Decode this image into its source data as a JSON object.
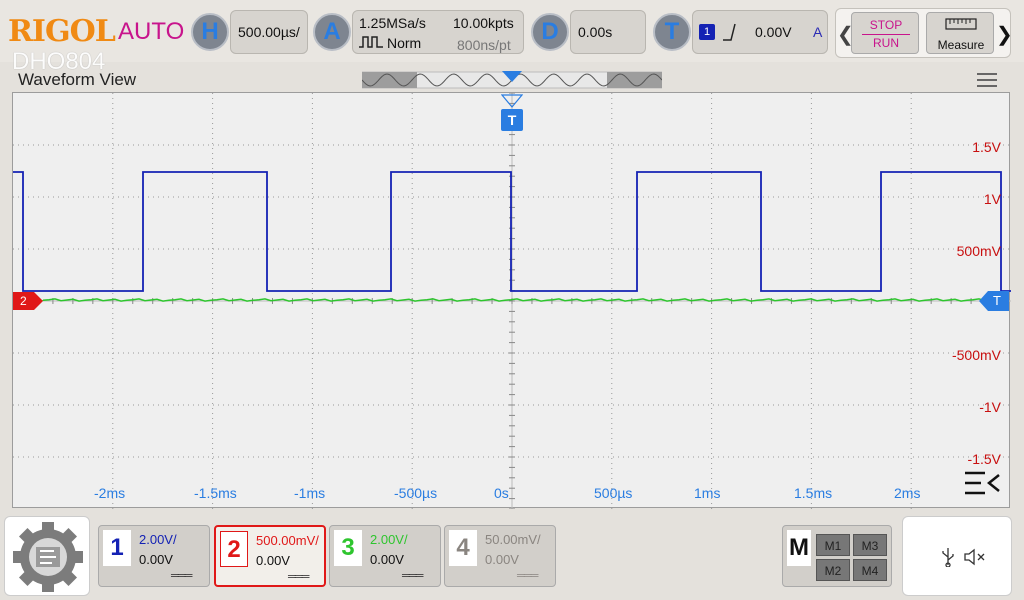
{
  "top": {
    "logo": "RIGOL",
    "mode": "AUTO",
    "model": "DHO804",
    "horizontal": {
      "badge": "H",
      "scale": "500.00µs/"
    },
    "acquire": {
      "badge": "A",
      "sample_rate": "1.25MSa/s",
      "memory": "10.00kpts",
      "mode": "Norm",
      "interval": "800ns/pt"
    },
    "delay": {
      "badge": "D",
      "value": "0.00s"
    },
    "trigger": {
      "badge": "T",
      "source": "1",
      "level": "0.00V",
      "mode": "A"
    },
    "run": {
      "stop": "STOP",
      "run": "RUN"
    },
    "measure": "Measure"
  },
  "waveform": {
    "title": "Waveform View",
    "trigger_marker": "T",
    "ch2_marker": "2",
    "trigger_level_marker": "T",
    "y_labels": [
      "1.5V",
      "1V",
      "500mV",
      "-500mV",
      "-1V",
      "-1.5V"
    ],
    "x_labels": [
      "-2ms",
      "-1.5ms",
      "-1ms",
      "-500µs",
      "0s",
      "500µs",
      "1ms",
      "1.5ms",
      "2ms"
    ],
    "colors": {
      "ch1": "#1422b4",
      "ch2": "#e01818",
      "ch3": "#2ec52e",
      "ch4": "#8a8580",
      "axis_labels": "#c81010",
      "time_labels": "#2a7de1"
    }
  },
  "channels": [
    {
      "num": "1",
      "scale": "2.00V/",
      "offset": "0.00V",
      "coupling": "═══",
      "color": "#1422b4"
    },
    {
      "num": "2",
      "scale": "500.00mV/",
      "offset": "0.00V",
      "coupling": "═══",
      "color": "#e01818"
    },
    {
      "num": "3",
      "scale": "2.00V/",
      "offset": "0.00V",
      "coupling": "═══",
      "color": "#2ec52e"
    },
    {
      "num": "4",
      "scale": "50.00mV/",
      "offset": "0.00V",
      "coupling": "═══",
      "color": "#8a8580"
    }
  ],
  "math": {
    "label": "M",
    "m1": "M1",
    "m2": "M2",
    "m3": "M3",
    "m4": "M4"
  },
  "status": {
    "usb": "usb-icon",
    "mute": "mute-icon"
  }
}
